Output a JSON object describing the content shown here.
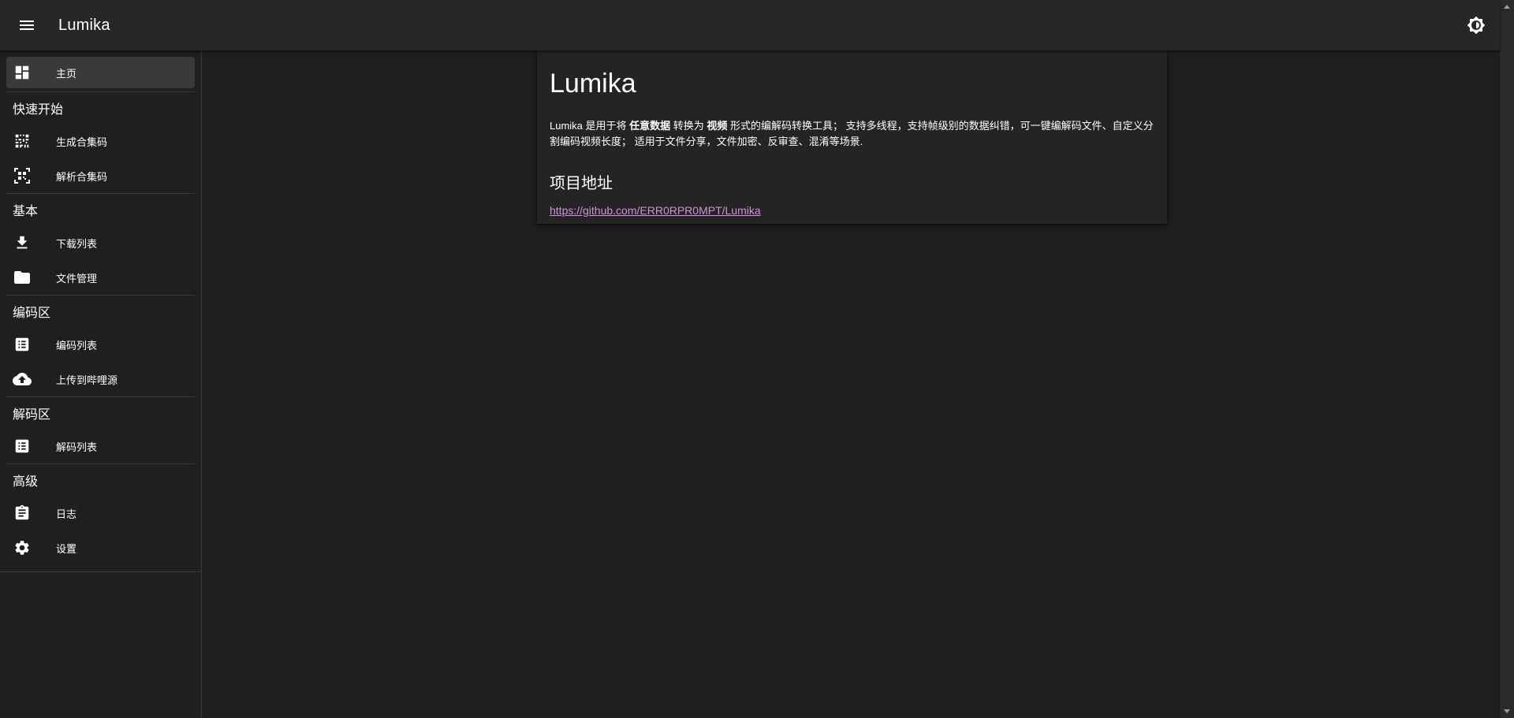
{
  "appbar": {
    "title": "Lumika",
    "menu_icon": "menu-icon",
    "theme_icon": "brightness-icon"
  },
  "sidebar": {
    "home": {
      "label": "主页",
      "icon": "dashboard-icon"
    },
    "sections": [
      {
        "title": "快速开始",
        "items": [
          {
            "label": "生成合集码",
            "icon": "qr-generate-icon"
          },
          {
            "label": "解析合集码",
            "icon": "qr-scan-icon"
          }
        ]
      },
      {
        "title": "基本",
        "items": [
          {
            "label": "下载列表",
            "icon": "download-icon"
          },
          {
            "label": "文件管理",
            "icon": "folder-icon"
          }
        ]
      },
      {
        "title": "编码区",
        "items": [
          {
            "label": "编码列表",
            "icon": "list-icon"
          },
          {
            "label": "上传到哔哩源",
            "icon": "cloud-upload-icon"
          }
        ]
      },
      {
        "title": "解码区",
        "items": [
          {
            "label": "解码列表",
            "icon": "list-icon"
          }
        ]
      },
      {
        "title": "高级",
        "items": [
          {
            "label": "日志",
            "icon": "clipboard-icon"
          },
          {
            "label": "设置",
            "icon": "gear-icon"
          }
        ]
      }
    ]
  },
  "main": {
    "title": "Lumika",
    "description": {
      "p1": "Lumika 是用于将 ",
      "b1": "任意数据",
      "p2": " 转换为 ",
      "b2": "视频",
      "p3": " 形式的编解码转换工具； 支持多线程，支持帧级别的数据纠错，可一键编解码文件、自定义分割编码视频长度； 适用于文件分享，文件加密、反审查、混淆等场景."
    },
    "project_heading": "项目地址",
    "project_link": "https://github.com/ERR0RPR0MPT/Lumika"
  },
  "colors": {
    "background": "#1f1f1f",
    "appbar": "#272727",
    "card": "#242424",
    "active_item": "#3a3a3a",
    "link": "#ce93d8"
  }
}
